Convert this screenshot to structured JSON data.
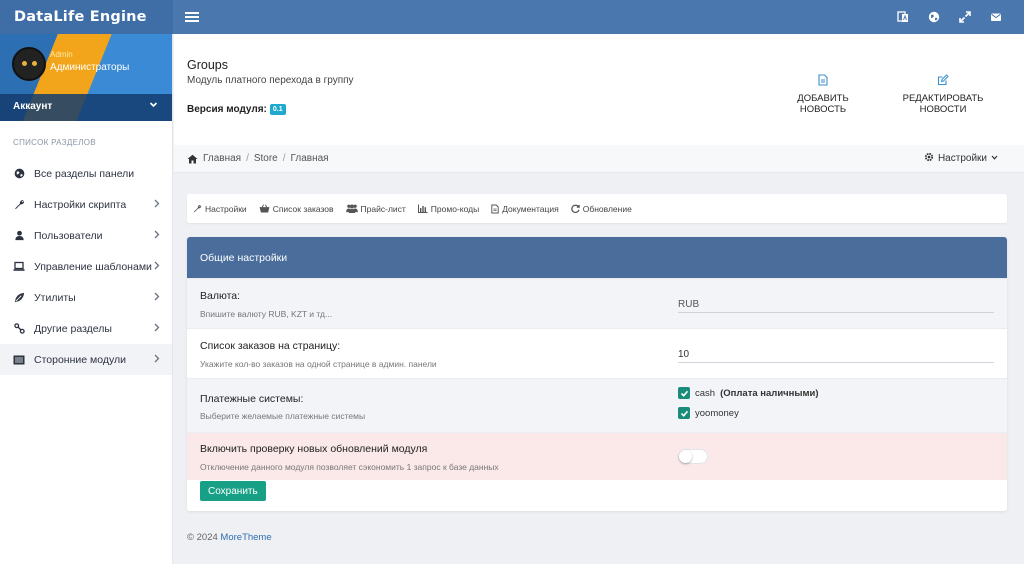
{
  "topbar": {
    "brand": "DataLife Engine",
    "icons": [
      "translate-icon",
      "globe-icon",
      "expand-icon",
      "mail-icon"
    ]
  },
  "sidebar": {
    "profile": {
      "role": "Admin",
      "group": "Администраторы",
      "account_label": "Аккаунт"
    },
    "section_title": "Список разделов",
    "items": [
      {
        "label": "Все разделы панели",
        "icon": "globe-icon",
        "chevron": false
      },
      {
        "label": "Настройки скрипта",
        "icon": "wrench-icon",
        "chevron": true
      },
      {
        "label": "Пользователи",
        "icon": "user-icon",
        "chevron": true
      },
      {
        "label": "Управление шаблонами",
        "icon": "laptop-icon",
        "chevron": true
      },
      {
        "label": "Утилиты",
        "icon": "leaf-icon",
        "chevron": true
      },
      {
        "label": "Другие разделы",
        "icon": "link-icon",
        "chevron": true
      },
      {
        "label": "Сторонние модули",
        "icon": "module-icon",
        "chevron": true,
        "active": true
      }
    ]
  },
  "header": {
    "title": "Groups",
    "subtitle": "Модуль платного перехода в группу",
    "version_label": "Версия модуля:",
    "version_value": "0.1",
    "add_news": "ДОБАВИТЬ НОВОСТЬ",
    "edit_news": "РЕДАКТИРОВАТЬ НОВОСТИ"
  },
  "breadcrumb": {
    "items": [
      "Главная",
      "Store",
      "Главная"
    ],
    "settings_label": "Настройки"
  },
  "tabs": [
    {
      "label": "Настройки",
      "icon": "wrench-icon"
    },
    {
      "label": "Список заказов",
      "icon": "basket-icon"
    },
    {
      "label": "Прайс-лист",
      "icon": "users-icon"
    },
    {
      "label": "Промо-коды",
      "icon": "bar-chart-icon"
    },
    {
      "label": "Документация",
      "icon": "document-icon"
    },
    {
      "label": "Обновление",
      "icon": "refresh-icon"
    }
  ],
  "settings": {
    "card_title": "Общие настройки",
    "currency": {
      "label": "Валюта:",
      "desc": "Впишите валюту RUB, KZT и тд...",
      "value": "RUB"
    },
    "orders_per_page": {
      "label": "Список заказов на страницу:",
      "desc": "Укажите кол-во заказов на одной странице в админ. панели",
      "value": "10"
    },
    "payments": {
      "label": "Платежные системы:",
      "desc": "Выберите желаемые платежные системы",
      "options": [
        {
          "name": "cash",
          "note": "(Оплата наличными)",
          "checked": true
        },
        {
          "name": "yoomoney",
          "note": "",
          "checked": true
        }
      ]
    },
    "updates": {
      "label": "Включить проверку новых обновлений модуля",
      "desc": "Отключение данного модуля позволяет сэкономить 1 запрос к базе данных",
      "enabled": false
    },
    "save_label": "Сохранить"
  },
  "footer": {
    "copyright": "© 2024",
    "link": "MoreTheme"
  },
  "colors": {
    "topbar": "#4a77ad",
    "card_head": "#4a6d9c",
    "accent": "#17a085",
    "badge": "#1fa9cf",
    "warn_row": "#fbe9e9"
  }
}
